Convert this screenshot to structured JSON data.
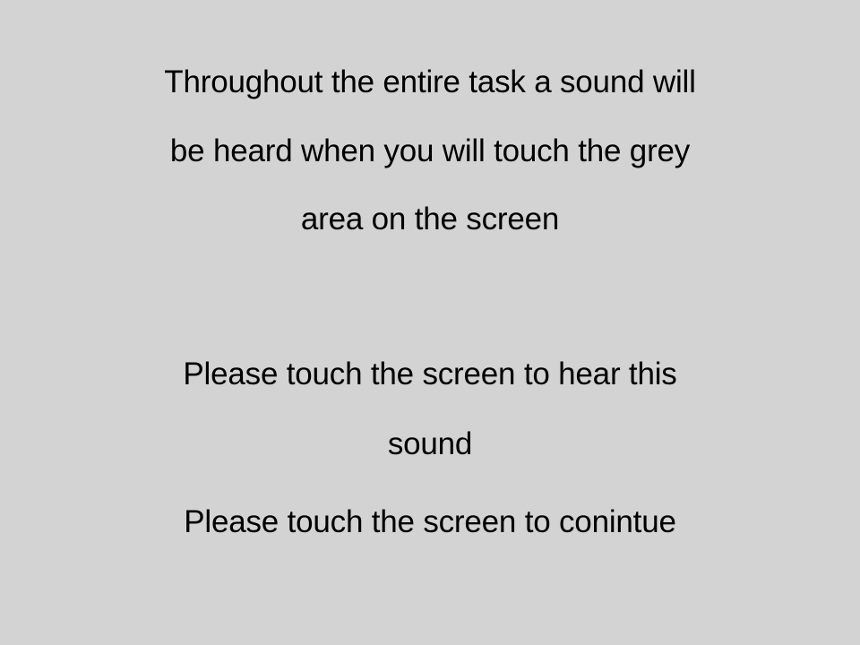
{
  "screen": {
    "background_color": "#d3d3d3",
    "text_color": "#000000"
  },
  "instruction": {
    "line1": "Throughout the entire task a sound will",
    "line2": "be heard when you will touch the grey",
    "line3": "area on the screen"
  },
  "prompt": {
    "line1": "Please touch the screen to hear this",
    "line2": "sound"
  },
  "continue_text": "Please touch the screen to conintue"
}
